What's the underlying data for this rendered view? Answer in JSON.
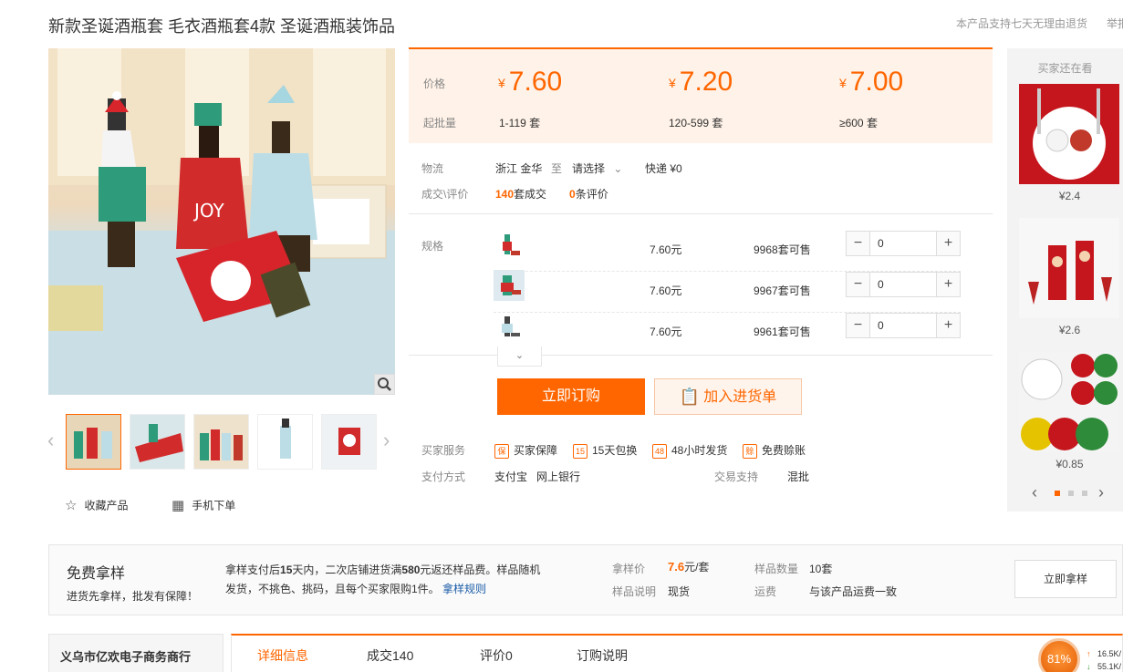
{
  "title": "新款圣诞酒瓶套 毛衣酒瓶套4款 圣诞酒瓶装饰品",
  "top_notes": [
    "本产品支持七天无理由退货",
    "举报"
  ],
  "gallery": {
    "thumb_count": 5,
    "prev_icon": "chevron-left-icon",
    "next_icon": "chevron-right-icon"
  },
  "actions": {
    "favorite": "收藏产品",
    "mobile_order": "手机下单"
  },
  "price_panel": {
    "price_label": "价格",
    "moq_label": "起批量",
    "currency": "¥",
    "tiers": [
      {
        "price": "7.60",
        "range": "1-119",
        "unit": "套"
      },
      {
        "price": "7.20",
        "range": "120-599",
        "unit": "套"
      },
      {
        "price": "7.00",
        "range": "≥600",
        "unit": "套"
      }
    ]
  },
  "logistics": {
    "label": "物流",
    "from": "浙江 金华",
    "to_word": "至",
    "select": "请选择",
    "express": "快递 ¥0"
  },
  "deals": {
    "label": "成交\\评价",
    "sold_count": "140",
    "sold_suffix": "套成交",
    "review_count": "0",
    "review_suffix": "条评价"
  },
  "spec": {
    "label": "规格",
    "rows": [
      {
        "price": "7.60元",
        "stock": "9968套可售",
        "qty": "0"
      },
      {
        "price": "7.60元",
        "stock": "9967套可售",
        "qty": "0"
      },
      {
        "price": "7.60元",
        "stock": "9961套可售",
        "qty": "0"
      }
    ]
  },
  "buttons": {
    "buy_now": "立即订购",
    "add_cart": "加入进货单"
  },
  "services": {
    "label": "买家服务",
    "items": [
      {
        "icon": "shield-icon",
        "glyph": "保",
        "text": "买家保障"
      },
      {
        "icon": "calendar-15-icon",
        "glyph": "15",
        "text": "15天包换"
      },
      {
        "icon": "clock-48-icon",
        "glyph": "48",
        "text": "48小时发货"
      },
      {
        "icon": "credit-icon",
        "glyph": "赊",
        "text": "免费赊账"
      }
    ]
  },
  "payment": {
    "label": "支付方式",
    "methods": [
      "支付宝",
      "网上银行"
    ],
    "trade_label": "交易支持",
    "trade_value": "混批"
  },
  "recommend": {
    "title": "买家还在看",
    "prices": [
      "¥2.4",
      "¥2.6",
      "¥0.85"
    ],
    "pager_active": 0,
    "pager_count": 3
  },
  "sample": {
    "title": "免费拿样",
    "subtitle": "进货先拿样，批发有保障！",
    "desc_a": "拿样支付后",
    "desc_days": "15",
    "desc_b": "天内，二次店铺进货满",
    "desc_amount": "580",
    "desc_c": "元返还样品费。样品随机发货，不挑色、挑码，且每个买家限购1件。",
    "rule_link": "拿样规则",
    "price_label": "拿样价",
    "price_value": "7.6",
    "price_unit": "元/套",
    "qty_label": "样品数量",
    "qty_value": "10套",
    "note_label": "样品说明",
    "note_value": "现货",
    "ship_label": "运费",
    "ship_value": "与该产品运费一致",
    "button": "立即拿样"
  },
  "shop": {
    "name": "义乌市亿欢电子商务商行"
  },
  "tabs": [
    "详细信息",
    "成交140",
    "评价0",
    "订购说明"
  ],
  "net_widget": {
    "percent": "81%",
    "up": "16.5K/",
    "down": "55.1K/"
  },
  "colors": {
    "accent": "#ff6600",
    "price_panel_bg": "#fff2e8"
  }
}
